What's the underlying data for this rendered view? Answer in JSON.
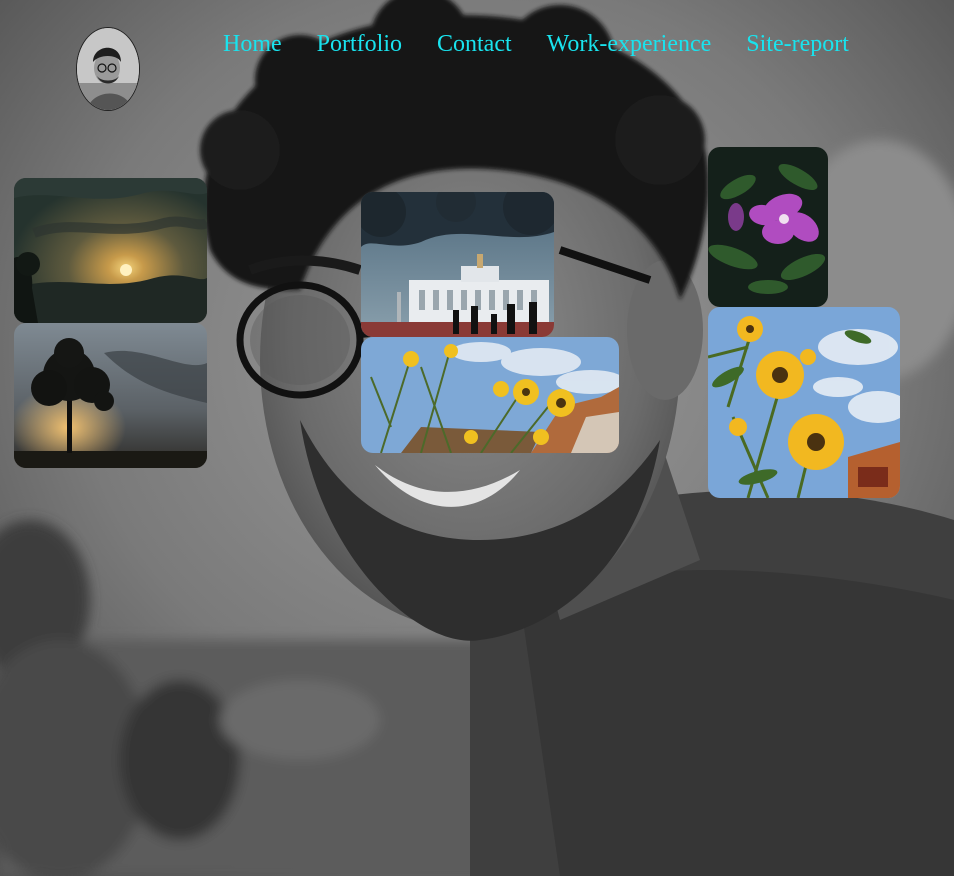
{
  "nav": {
    "items": [
      {
        "label": "Home"
      },
      {
        "label": "Portfolio"
      },
      {
        "label": "Contact"
      },
      {
        "label": "Work-experience"
      },
      {
        "label": "Site-report"
      }
    ],
    "link_color": "#19e3ee"
  },
  "gallery": [
    {
      "name": "sunset-clouds-photo"
    },
    {
      "name": "tree-silhouette-photo"
    },
    {
      "name": "white-temple-photo"
    },
    {
      "name": "yellow-flowers-building-photo"
    },
    {
      "name": "purple-flower-photo"
    },
    {
      "name": "yellow-flowers-sky-photo"
    }
  ]
}
